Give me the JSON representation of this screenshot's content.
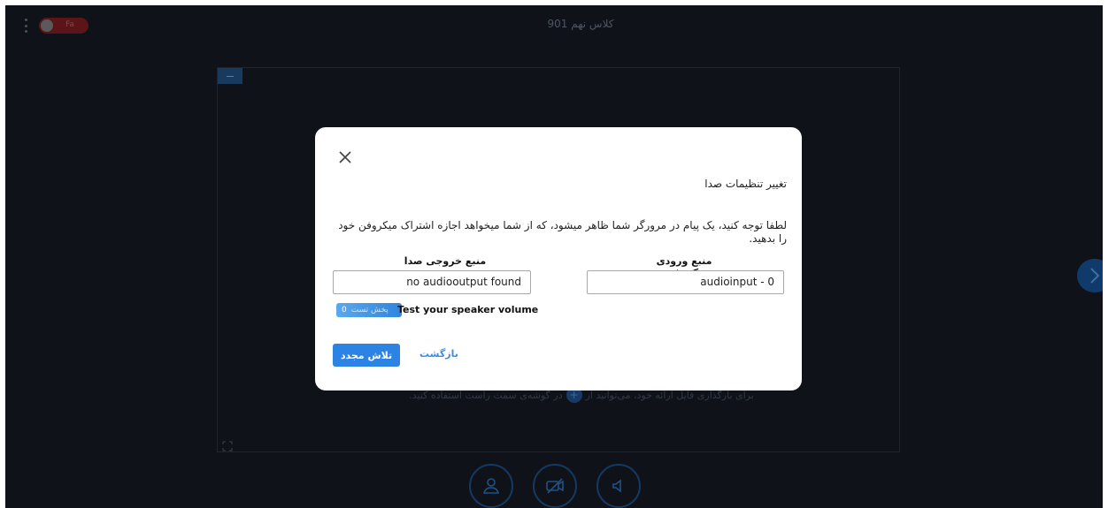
{
  "header": {
    "class_title": "کلاس نهم 901",
    "language_toggle_label": "Fa"
  },
  "stage": {
    "hint_text": "برای بارگذاری فایل ارائه خود، می‌توانید از",
    "hint_text_after": "در گوشه‌ی سمت راست استفاده کنید.",
    "hint_icon_glyph": "+"
  },
  "dialog": {
    "title": "تغییر تنظیمات صدا",
    "notice": "لطفا توجه کنید، یک پیام در مرورگر شما ظاهر میشود، که از شما میخواهد اجازه اشتراک میکروفن خود را بدهید.",
    "mic_label": "منبع ورودی میکروفون",
    "mic_value": "audioinput - 0",
    "output_label": "منبع خروجی صدا",
    "output_value": "no audiooutput found",
    "speaker_test_label": "Test your speaker volume",
    "volume_value": "0",
    "volume_button_text": "پخش تست",
    "retry_label": "تلاش مجدد",
    "back_label": "بازگشت"
  },
  "colors": {
    "app_background": "#0f1319",
    "modal_background": "#ffffff",
    "primary": "#2d83e4",
    "link": "#3a8ee6",
    "lang_toggle": "#5b1518"
  },
  "icons": {
    "close": "close-icon",
    "menu": "vertical-dots-icon",
    "next": "chevron-right-icon",
    "fullscreen": "fullscreen-icon",
    "user": "user-icon",
    "camera": "camera-off-icon",
    "speaker": "speaker-icon"
  }
}
